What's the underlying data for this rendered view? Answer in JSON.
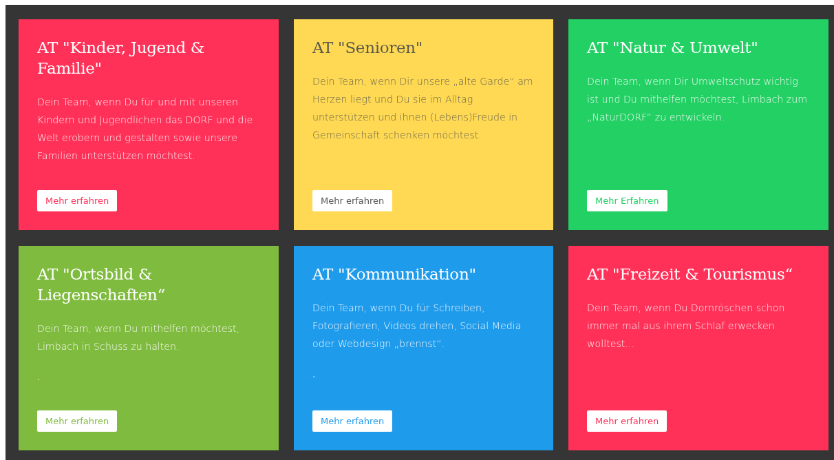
{
  "cards": [
    {
      "title": "AT \"Kinder, Jugend & Familie\"",
      "text": "Dein Team, wenn Du für und mit unseren Kindern und Jugendlichen das DORF und die Welt erobern und gestalten sowie unsere Familien unterstützen möchtest.",
      "button": "Mehr erfahren",
      "color": "#ff3158"
    },
    {
      "title": "AT \"Senioren\"",
      "text": "Dein Team, wenn Dir unsere „alte Garde“ am Herzen liegt und Du sie im Alltag unterstützen und ihnen (Lebens)Freude in Gemeinschaft schenken möchtest.",
      "button": "Mehr erfahren",
      "color": "#ffd954"
    },
    {
      "title": "AT \"Natur & Umwelt\"",
      "text": "Dein Team, wenn Dir Umweltschutz wichtig ist und Du mithelfen möchtest, Limbach zum „NaturDORF“ zu entwickeln.",
      "button": "Mehr Erfahren",
      "color": "#22d063"
    },
    {
      "title": "AT \"Ortsbild & Liegenschaften“",
      "text": "Dein Team, wenn Du mithelfen möchtest, Limbach in Schuss zu halten.",
      "note": ".",
      "button": "Mehr erfahren",
      "color": "#7fbb3e"
    },
    {
      "title": "AT \"Kommunikation\"",
      "text": "Dein Team, wenn Du für Schreiben, Fotografieren, Videos drehen, Social Media oder Webdesign „brennst“.",
      "note": ".",
      "button": "Mehr erfahren",
      "color": "#1f9bec"
    },
    {
      "title": "AT \"Freizeit & Tourismus“",
      "text": "Dein Team, wenn Du Dornröschen schon immer mal aus ihrem Schlaf erwecken wolltest...",
      "button": "Mehr erfahren",
      "color": "#ff3158"
    }
  ]
}
